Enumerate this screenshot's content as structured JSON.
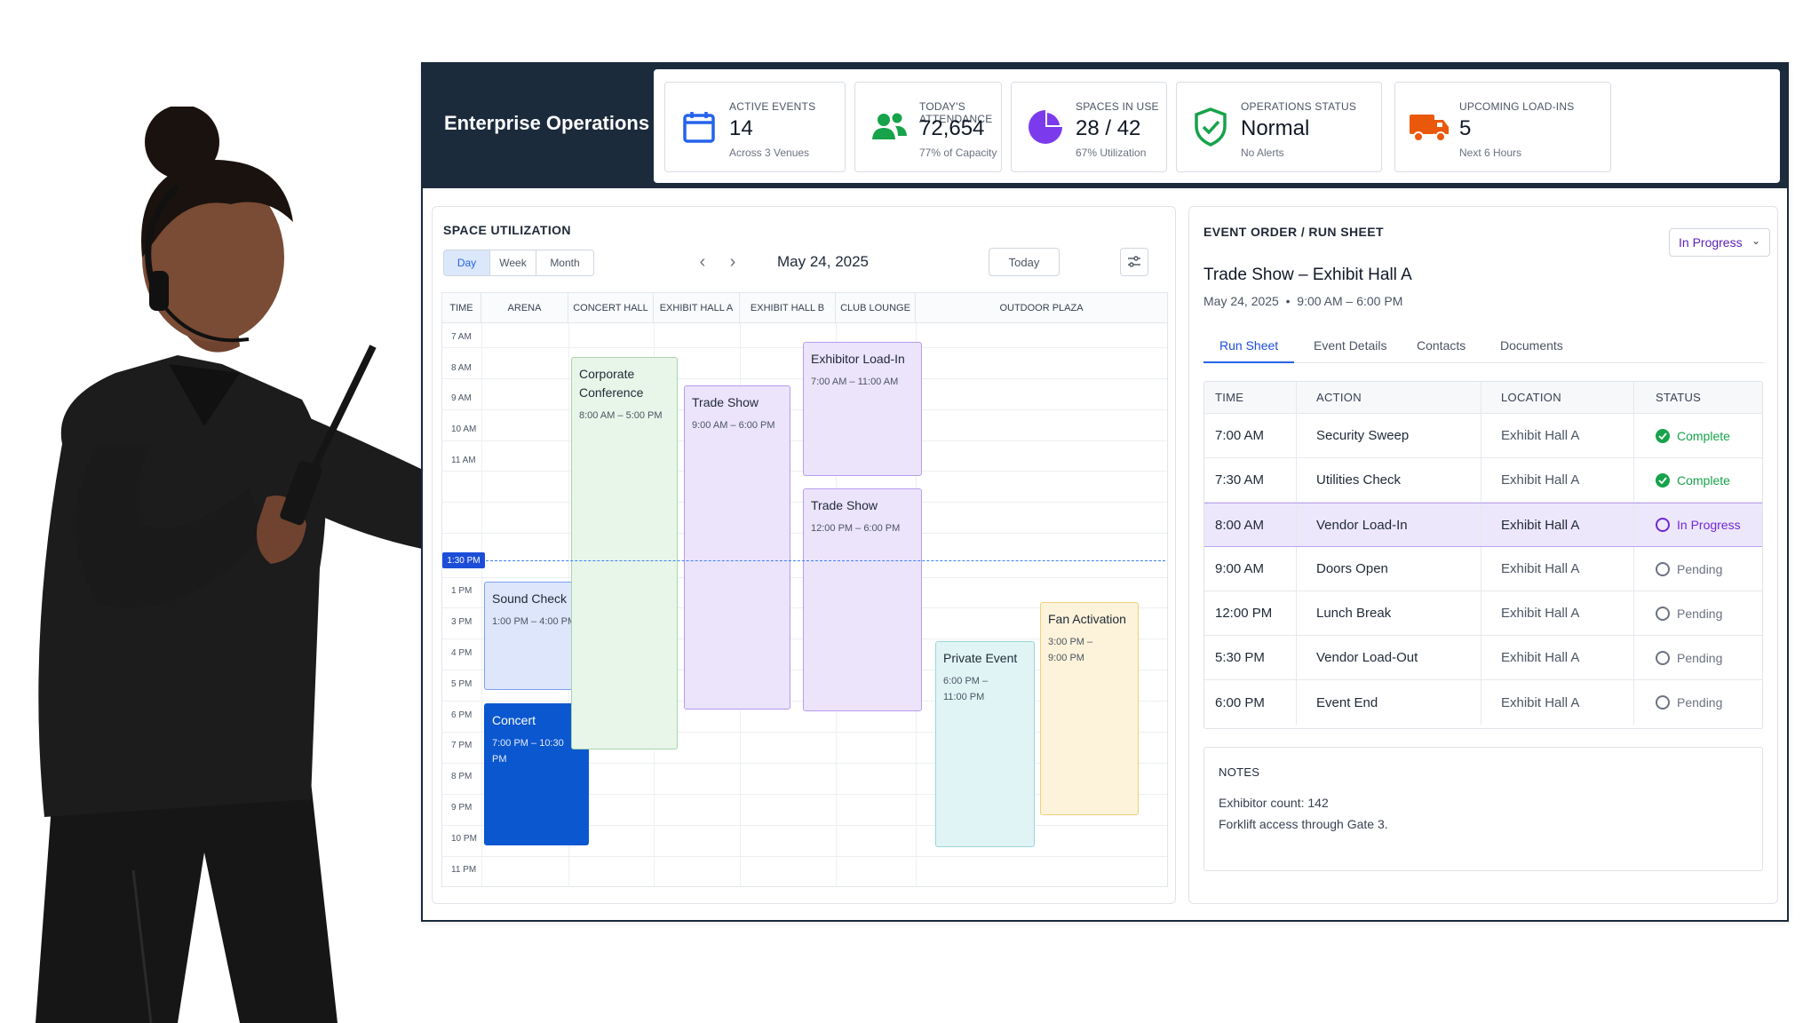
{
  "app": {
    "title": "Enterprise Operations",
    "accent_color": "#2563eb",
    "topbar_color": "#1c2b3c"
  },
  "kpis": [
    {
      "label": "ACTIVE EVENTS",
      "value": "14",
      "sub": "Across 3 Venues",
      "icon": "calendar-icon",
      "color": "#2563eb"
    },
    {
      "label": "TODAY'S ATTENDANCE",
      "value": "72,654",
      "sub": "77% of Capacity",
      "icon": "users-icon",
      "color": "#16a34a"
    },
    {
      "label": "SPACES IN USE",
      "value": "28 / 42",
      "sub": "67% Utilization",
      "icon": "pie-icon",
      "color": "#7c3aed",
      "fraction": 0.67
    },
    {
      "label": "OPERATIONS STATUS",
      "value": "Normal",
      "sub": "No Alerts",
      "icon": "shield-check-icon",
      "color": "#16a34a"
    },
    {
      "label": "UPCOMING LOAD-INS",
      "value": "5",
      "sub": "Next 6 Hours",
      "icon": "truck-icon",
      "color": "#ea580c"
    }
  ],
  "space_utilization": {
    "title": "SPACE UTILIZATION",
    "views": [
      "Day",
      "Week",
      "Month"
    ],
    "active_view": "Day",
    "date": "May 24, 2025",
    "today_label": "Today",
    "columns": [
      "TIME",
      "ARENA",
      "CONCERT HALL",
      "EXHIBIT HALL A",
      "EXHIBIT HALL B",
      "CLUB LOUNGE",
      "OUTDOOR PLAZA"
    ],
    "times": [
      "7 AM",
      "8 AM",
      "9 AM",
      "10 AM",
      "11 AM",
      "1 PM",
      "3 PM",
      "4 PM",
      "5 PM",
      "6 PM",
      "7 PM",
      "8 PM",
      "9 PM",
      "10 PM",
      "11 PM"
    ],
    "now_label": "1:30 PM",
    "events": [
      {
        "title": "Sound Check",
        "time": "1:00 PM – 4:00 PM",
        "venue": "ARENA",
        "bg": "#dde6fb",
        "border": "#7ea0ee"
      },
      {
        "title": "Concert",
        "time": "7:00 PM – 10:30 PM",
        "venue": "ARENA",
        "bg": "#0b57d0",
        "border": "#0b57d0"
      },
      {
        "title": "Corporate Conference",
        "time": "8:00 AM – 5:00 PM",
        "venue": "CONCERT HALL",
        "bg": "#e8f5e9",
        "border": "#a8d5ad"
      },
      {
        "title": "Trade Show",
        "time": "9:00 AM – 6:00 PM",
        "venue": "EXHIBIT HALL A",
        "bg": "#ece4fb",
        "border": "#b69cf0"
      },
      {
        "title": "Exhibitor Load-In",
        "time": "7:00 AM – 11:00 AM",
        "venue": "EXHIBIT HALL B",
        "bg": "#ece4fb",
        "border": "#b69cf0"
      },
      {
        "title": "Trade Show",
        "time": "12:00 PM – 6:00 PM",
        "venue": "EXHIBIT HALL B",
        "bg": "#ece4fb",
        "border": "#b69cf0"
      },
      {
        "title": "Private Event",
        "time": "6:00 PM – 11:00 PM",
        "venue": "CLUB LOUNGE",
        "bg": "#e0f4f5",
        "border": "#9fd5d8"
      },
      {
        "title": "Fan Activation",
        "time": "3:00 PM – 9:00 PM",
        "venue": "OUTDOOR PLAZA",
        "bg": "#fdf3da",
        "border": "#f0cf7a"
      }
    ]
  },
  "run_sheet": {
    "title": "EVENT ORDER / RUN SHEET",
    "status_dropdown": "In Progress",
    "event_title": "Trade Show – Exhibit Hall A",
    "event_meta": "May 24, 2025  •  9:00 AM – 6:00 PM",
    "tabs": [
      "Run Sheet",
      "Event Details",
      "Contacts",
      "Documents"
    ],
    "active_tab": "Run Sheet",
    "headers": [
      "TIME",
      "ACTION",
      "LOCATION",
      "STATUS"
    ],
    "rows": [
      {
        "time": "7:00 AM",
        "action": "Security Sweep",
        "location": "Exhibit Hall A",
        "status": "Complete"
      },
      {
        "time": "7:30 AM",
        "action": "Utilities Check",
        "location": "Exhibit Hall A",
        "status": "Complete"
      },
      {
        "time": "8:00 AM",
        "action": "Vendor Load-In",
        "location": "Exhibit Hall A",
        "status": "In Progress"
      },
      {
        "time": "9:00 AM",
        "action": "Doors Open",
        "location": "Exhibit Hall A",
        "status": "Pending"
      },
      {
        "time": "12:00 PM",
        "action": "Lunch Break",
        "location": "Exhibit Hall A",
        "status": "Pending"
      },
      {
        "time": "5:30 PM",
        "action": "Vendor Load-Out",
        "location": "Exhibit Hall A",
        "status": "Pending"
      },
      {
        "time": "6:00 PM",
        "action": "Event End",
        "location": "Exhibit Hall A",
        "status": "Pending"
      }
    ],
    "status_colors": {
      "Complete": "#16a34a",
      "In Progress": "#6d28d9",
      "Pending": "#6b7280"
    }
  },
  "notes": {
    "title": "NOTES",
    "lines": [
      "Exhibitor count: 142",
      "Forklift access through Gate 3."
    ]
  }
}
